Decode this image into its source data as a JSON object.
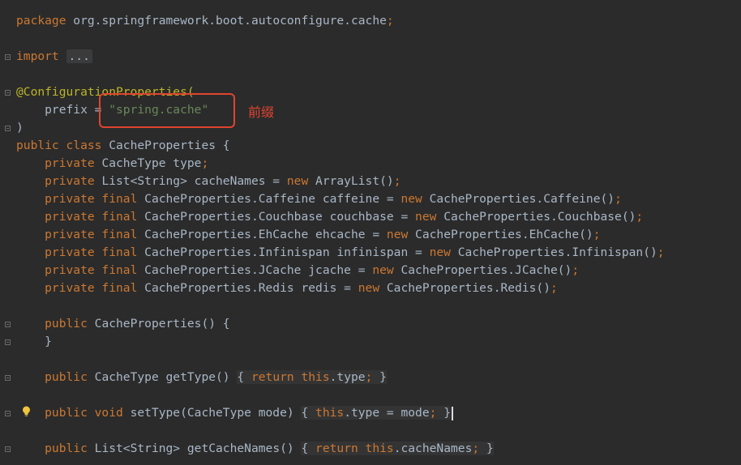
{
  "editor": {
    "lines": {
      "package_kw": "package",
      "package_name": " org.springframework.boot.autoconfigure.cache",
      "semicolon": ";",
      "import_kw": "import",
      "import_fold": "...",
      "annotation_open": "@ConfigurationProperties(",
      "prefix_lhs": "    prefix = ",
      "prefix_value": "\"spring.cache\"",
      "annotation_close": ")",
      "class_public": "public",
      "class_kw": " class",
      "class_name": " CacheProperties {",
      "f1_private": "    private",
      "f1_rest": " CacheType type",
      "f2_private": "    private",
      "f2_rest": " List<String> cacheNames = ",
      "f2_new": "new",
      "f2_tail": " ArrayList()",
      "f3_private": "    private final",
      "f3_rest": " CacheProperties.Caffeine caffeine = ",
      "f3_new": "new",
      "f3_tail": " CacheProperties.Caffeine()",
      "f4_private": "    private final",
      "f4_rest": " CacheProperties.Couchbase couchbase = ",
      "f4_new": "new",
      "f4_tail": " CacheProperties.Couchbase()",
      "f5_private": "    private final",
      "f5_rest": " CacheProperties.EhCache ehcache = ",
      "f5_new": "new",
      "f5_tail": " CacheProperties.EhCache()",
      "f6_private": "    private final",
      "f6_rest": " CacheProperties.Infinispan infinispan = ",
      "f6_new": "new",
      "f6_tail": " CacheProperties.Infinispan()",
      "f7_private": "    private final",
      "f7_rest": " CacheProperties.JCache jcache = ",
      "f7_new": "new",
      "f7_tail": " CacheProperties.JCache()",
      "f8_private": "    private final",
      "f8_rest": " CacheProperties.Redis redis = ",
      "f8_new": "new",
      "f8_tail": " CacheProperties.Redis()",
      "ctor_public": "    public",
      "ctor_rest": " CacheProperties() {",
      "ctor_close": "    }",
      "m1_public": "    public",
      "m1_sig": " CacheType getType() ",
      "m1_open": "{ ",
      "m1_return": "return",
      "m1_this": " this",
      "m1_field": ".type",
      "m1_close": " }",
      "m2_public": "    public void",
      "m2_sig": " setType(CacheType mode) ",
      "m2_open": "{ ",
      "m2_this": "this",
      "m2_body": ".type = mode",
      "m2_close": " }",
      "m3_public": "    public",
      "m3_sig": " List<String> getCacheNames() ",
      "m3_open": "{ ",
      "m3_return": "return",
      "m3_this": " this",
      "m3_field": ".cacheNames",
      "m3_close": " }"
    }
  },
  "annotation": {
    "label": "前缀"
  },
  "colors": {
    "background": "#2b2b2b",
    "keyword": "#cc7832",
    "string": "#6a8759",
    "annotation": "#bbb529",
    "text": "#a9b7c6",
    "highlight_box": "#e0442f"
  }
}
